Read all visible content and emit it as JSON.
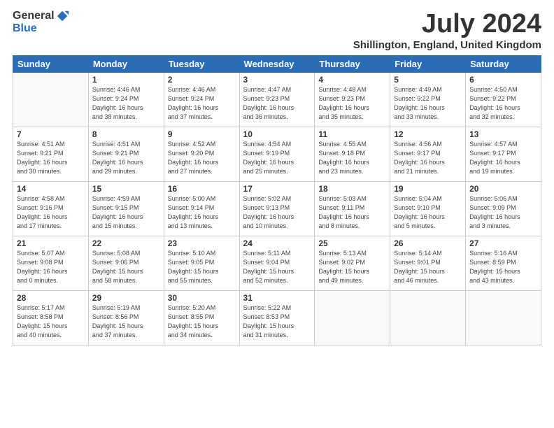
{
  "logo": {
    "general": "General",
    "blue": "Blue"
  },
  "title": "July 2024",
  "location": "Shillington, England, United Kingdom",
  "days_of_week": [
    "Sunday",
    "Monday",
    "Tuesday",
    "Wednesday",
    "Thursday",
    "Friday",
    "Saturday"
  ],
  "weeks": [
    [
      {
        "day": "",
        "info": ""
      },
      {
        "day": "1",
        "info": "Sunrise: 4:46 AM\nSunset: 9:24 PM\nDaylight: 16 hours\nand 38 minutes."
      },
      {
        "day": "2",
        "info": "Sunrise: 4:46 AM\nSunset: 9:24 PM\nDaylight: 16 hours\nand 37 minutes."
      },
      {
        "day": "3",
        "info": "Sunrise: 4:47 AM\nSunset: 9:23 PM\nDaylight: 16 hours\nand 36 minutes."
      },
      {
        "day": "4",
        "info": "Sunrise: 4:48 AM\nSunset: 9:23 PM\nDaylight: 16 hours\nand 35 minutes."
      },
      {
        "day": "5",
        "info": "Sunrise: 4:49 AM\nSunset: 9:22 PM\nDaylight: 16 hours\nand 33 minutes."
      },
      {
        "day": "6",
        "info": "Sunrise: 4:50 AM\nSunset: 9:22 PM\nDaylight: 16 hours\nand 32 minutes."
      }
    ],
    [
      {
        "day": "7",
        "info": "Sunrise: 4:51 AM\nSunset: 9:21 PM\nDaylight: 16 hours\nand 30 minutes."
      },
      {
        "day": "8",
        "info": "Sunrise: 4:51 AM\nSunset: 9:21 PM\nDaylight: 16 hours\nand 29 minutes."
      },
      {
        "day": "9",
        "info": "Sunrise: 4:52 AM\nSunset: 9:20 PM\nDaylight: 16 hours\nand 27 minutes."
      },
      {
        "day": "10",
        "info": "Sunrise: 4:54 AM\nSunset: 9:19 PM\nDaylight: 16 hours\nand 25 minutes."
      },
      {
        "day": "11",
        "info": "Sunrise: 4:55 AM\nSunset: 9:18 PM\nDaylight: 16 hours\nand 23 minutes."
      },
      {
        "day": "12",
        "info": "Sunrise: 4:56 AM\nSunset: 9:17 PM\nDaylight: 16 hours\nand 21 minutes."
      },
      {
        "day": "13",
        "info": "Sunrise: 4:57 AM\nSunset: 9:17 PM\nDaylight: 16 hours\nand 19 minutes."
      }
    ],
    [
      {
        "day": "14",
        "info": "Sunrise: 4:58 AM\nSunset: 9:16 PM\nDaylight: 16 hours\nand 17 minutes."
      },
      {
        "day": "15",
        "info": "Sunrise: 4:59 AM\nSunset: 9:15 PM\nDaylight: 16 hours\nand 15 minutes."
      },
      {
        "day": "16",
        "info": "Sunrise: 5:00 AM\nSunset: 9:14 PM\nDaylight: 16 hours\nand 13 minutes."
      },
      {
        "day": "17",
        "info": "Sunrise: 5:02 AM\nSunset: 9:13 PM\nDaylight: 16 hours\nand 10 minutes."
      },
      {
        "day": "18",
        "info": "Sunrise: 5:03 AM\nSunset: 9:11 PM\nDaylight: 16 hours\nand 8 minutes."
      },
      {
        "day": "19",
        "info": "Sunrise: 5:04 AM\nSunset: 9:10 PM\nDaylight: 16 hours\nand 5 minutes."
      },
      {
        "day": "20",
        "info": "Sunrise: 5:06 AM\nSunset: 9:09 PM\nDaylight: 16 hours\nand 3 minutes."
      }
    ],
    [
      {
        "day": "21",
        "info": "Sunrise: 5:07 AM\nSunset: 9:08 PM\nDaylight: 16 hours\nand 0 minutes."
      },
      {
        "day": "22",
        "info": "Sunrise: 5:08 AM\nSunset: 9:06 PM\nDaylight: 15 hours\nand 58 minutes."
      },
      {
        "day": "23",
        "info": "Sunrise: 5:10 AM\nSunset: 9:05 PM\nDaylight: 15 hours\nand 55 minutes."
      },
      {
        "day": "24",
        "info": "Sunrise: 5:11 AM\nSunset: 9:04 PM\nDaylight: 15 hours\nand 52 minutes."
      },
      {
        "day": "25",
        "info": "Sunrise: 5:13 AM\nSunset: 9:02 PM\nDaylight: 15 hours\nand 49 minutes."
      },
      {
        "day": "26",
        "info": "Sunrise: 5:14 AM\nSunset: 9:01 PM\nDaylight: 15 hours\nand 46 minutes."
      },
      {
        "day": "27",
        "info": "Sunrise: 5:16 AM\nSunset: 8:59 PM\nDaylight: 15 hours\nand 43 minutes."
      }
    ],
    [
      {
        "day": "28",
        "info": "Sunrise: 5:17 AM\nSunset: 8:58 PM\nDaylight: 15 hours\nand 40 minutes."
      },
      {
        "day": "29",
        "info": "Sunrise: 5:19 AM\nSunset: 8:56 PM\nDaylight: 15 hours\nand 37 minutes."
      },
      {
        "day": "30",
        "info": "Sunrise: 5:20 AM\nSunset: 8:55 PM\nDaylight: 15 hours\nand 34 minutes."
      },
      {
        "day": "31",
        "info": "Sunrise: 5:22 AM\nSunset: 8:53 PM\nDaylight: 15 hours\nand 31 minutes."
      },
      {
        "day": "",
        "info": ""
      },
      {
        "day": "",
        "info": ""
      },
      {
        "day": "",
        "info": ""
      }
    ]
  ]
}
